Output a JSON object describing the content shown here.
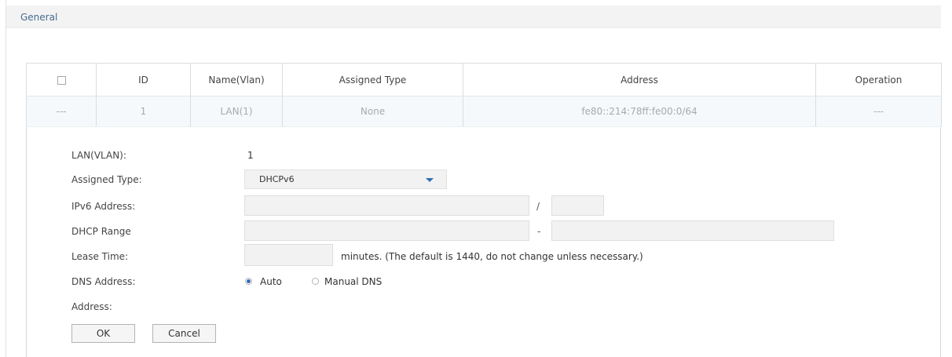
{
  "section": {
    "title": "General"
  },
  "table": {
    "columns": [
      "ID",
      "Name(Vlan)",
      "Assigned Type",
      "Address",
      "Operation"
    ],
    "row": {
      "checkbox": "---",
      "id": "1",
      "name": "LAN(1)",
      "assigned_type": "None",
      "address": "fe80::214:78ff:fe00:0/64",
      "operation": "---"
    }
  },
  "form": {
    "lan_vlan_label": "LAN(VLAN):",
    "lan_vlan_value": "1",
    "assigned_type_label": "Assigned Type:",
    "assigned_type_value": "DHCPv6",
    "ipv6_address_label": "IPv6 Address:",
    "ipv6_address_value": "",
    "prefix_separator": "/",
    "prefix_length_value": "",
    "dhcp_range_label": "DHCP Range",
    "dhcp_range_start_value": "",
    "range_separator": "-",
    "dhcp_range_end_value": "",
    "lease_time_label": "Lease Time:",
    "lease_time_value": "",
    "lease_time_hint": "minutes. (The default is 1440, do not change unless necessary.)",
    "dns_address_label": "DNS Address:",
    "dns_auto_label": "Auto",
    "dns_manual_label": "Manual DNS",
    "dns_selected": "Auto",
    "address_label": "Address:",
    "ok_label": "OK",
    "cancel_label": "Cancel"
  },
  "colors": {
    "accent": "#2f6eb5",
    "section_title": "#466b8c",
    "input_bg": "#f2f2f2",
    "row_highlight": "#f5f9fc"
  },
  "icons": {
    "dropdown": "chevron-down-icon",
    "checkbox": "checkbox-icon",
    "radio_selected": "radio-checked-icon",
    "radio_unselected": "radio-unchecked-icon"
  }
}
